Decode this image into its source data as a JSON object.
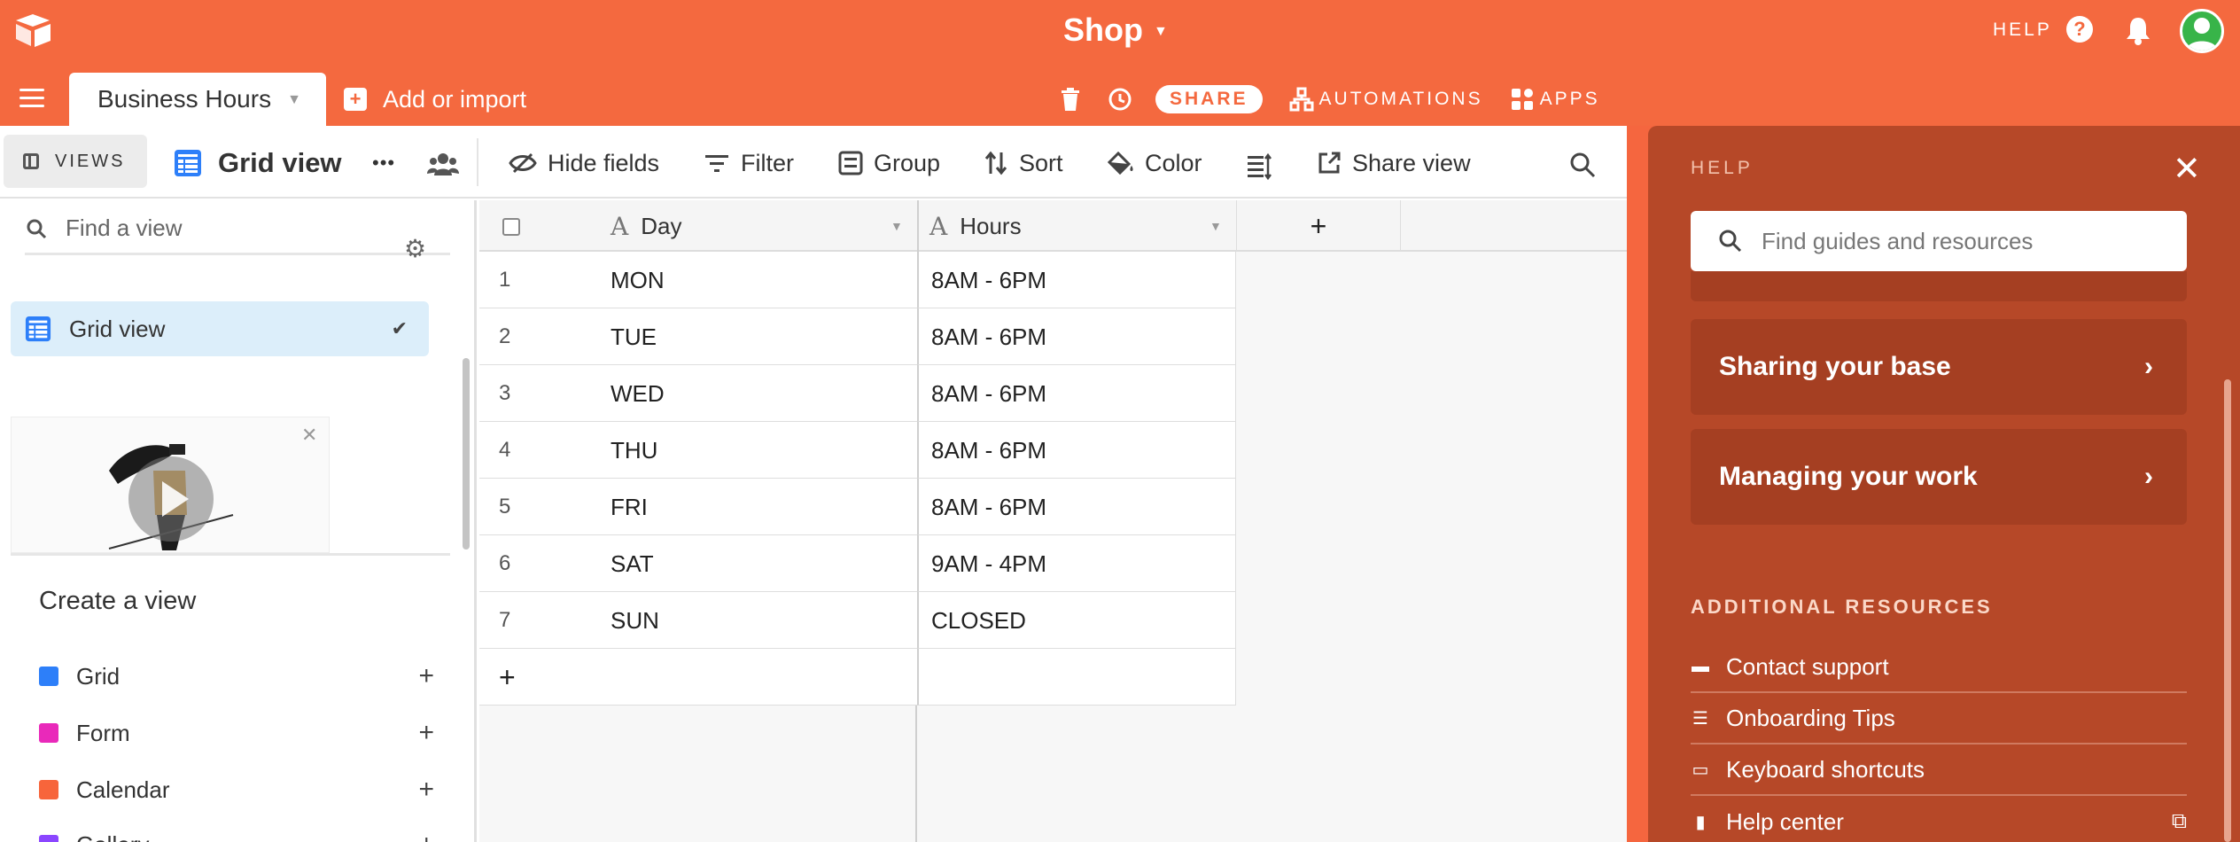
{
  "header": {
    "base_title": "Shop",
    "help_label": "HELP",
    "help_icon_glyph": "?"
  },
  "tabbar": {
    "table_tab": "Business Hours",
    "add_import": "Add or import",
    "share": "SHARE",
    "automations": "AUTOMATIONS",
    "apps": "APPS"
  },
  "viewbar": {
    "views": "VIEWS",
    "current_view": "Grid view",
    "more": "•••",
    "hide_fields": "Hide fields",
    "filter": "Filter",
    "group": "Group",
    "sort": "Sort",
    "color": "Color",
    "share_view": "Share view"
  },
  "sidebar": {
    "find_placeholder": "Find a view",
    "active_view": "Grid view",
    "create_title": "Create a view",
    "create_items": [
      {
        "label": "Grid",
        "color": "#2d7ff9"
      },
      {
        "label": "Form",
        "color": "#e929ba"
      },
      {
        "label": "Calendar",
        "color": "#f7653b"
      },
      {
        "label": "Gallery",
        "color": "#8b46ff"
      }
    ]
  },
  "table": {
    "columns": [
      "Day",
      "Hours"
    ],
    "add_column": "+",
    "rows": [
      {
        "num": "1",
        "day": "MON",
        "hours": "8AM - 6PM"
      },
      {
        "num": "2",
        "day": "TUE",
        "hours": "8AM - 6PM"
      },
      {
        "num": "3",
        "day": "WED",
        "hours": "8AM - 6PM"
      },
      {
        "num": "4",
        "day": "THU",
        "hours": "8AM - 6PM"
      },
      {
        "num": "5",
        "day": "FRI",
        "hours": "8AM - 6PM"
      },
      {
        "num": "6",
        "day": "SAT",
        "hours": "9AM - 4PM"
      },
      {
        "num": "7",
        "day": "SUN",
        "hours": "CLOSED"
      }
    ],
    "add_row": "+"
  },
  "help_panel": {
    "label": "HELP",
    "search_placeholder": "Find guides and resources",
    "cards": [
      "Sharing your base",
      "Managing your work"
    ],
    "additional_title": "ADDITIONAL RESOURCES",
    "links": [
      "Contact support",
      "Onboarding Tips",
      "Keyboard shortcuts",
      "Help center"
    ]
  },
  "colors": {
    "brand": "#f4693f",
    "help_panel": "#b64828",
    "selected_view": "#dceefa"
  }
}
